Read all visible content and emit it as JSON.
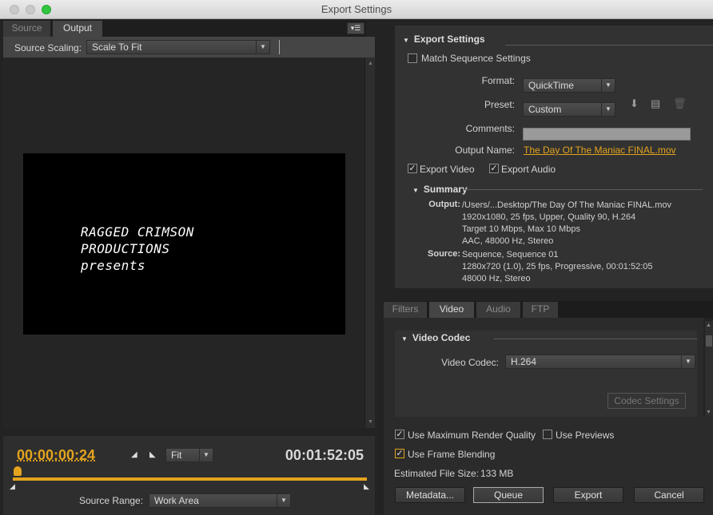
{
  "window": {
    "title": "Export Settings"
  },
  "left": {
    "tabs": [
      {
        "label": "Source"
      },
      {
        "label": "Output"
      }
    ],
    "panel_menu_glyph": "▾☰",
    "source_scaling": {
      "label": "Source Scaling:",
      "value": "Scale To Fit"
    },
    "preview_text": [
      "RAGGED CRIMSON",
      "PRODUCTIONS",
      "presents"
    ],
    "timecode_current": "00:00:00:24",
    "timecode_duration": "00:01:52:05",
    "zoom": "Fit",
    "source_range": {
      "label": "Source Range:",
      "value": "Work Area"
    }
  },
  "export_settings": {
    "title": "Export Settings",
    "match_sequence": {
      "label": "Match Sequence Settings",
      "checked": false
    },
    "format": {
      "label": "Format:",
      "value": "QuickTime"
    },
    "preset": {
      "label": "Preset:",
      "value": "Custom"
    },
    "comments": {
      "label": "Comments:",
      "value": ""
    },
    "output_name": {
      "label": "Output Name:",
      "value": "The Day Of The Maniac FINAL.mov"
    },
    "export_video": {
      "label": "Export Video",
      "checked": true
    },
    "export_audio": {
      "label": "Export Audio",
      "checked": true
    },
    "summary": {
      "title": "Summary",
      "output_label": "Output:",
      "output_lines": [
        "/Users/...Desktop/The Day Of The Maniac FINAL.mov",
        "1920x1080, 25 fps, Upper, Quality 90, H.264",
        "Target 10 Mbps, Max 10 Mbps",
        "AAC, 48000 Hz, Stereo"
      ],
      "source_label": "Source:",
      "source_lines": [
        "Sequence, Sequence 01",
        "1280x720 (1.0), 25 fps, Progressive, 00:01:52:05",
        "48000 Hz, Stereo"
      ]
    }
  },
  "settings_tabs": [
    {
      "label": "Filters"
    },
    {
      "label": "Video"
    },
    {
      "label": "Audio"
    },
    {
      "label": "FTP"
    }
  ],
  "video_codec": {
    "title": "Video Codec",
    "label": "Video Codec:",
    "value": "H.264",
    "settings_button": "Codec Settings"
  },
  "bottom": {
    "max_render": {
      "label": "Use Maximum Render Quality",
      "checked": true
    },
    "use_previews": {
      "label": "Use Previews",
      "checked": false
    },
    "frame_blending": {
      "label": "Use Frame Blending",
      "checked": true
    },
    "file_size_label": "Estimated File Size:",
    "file_size_value": "133 MB",
    "buttons": {
      "metadata": "Metadata...",
      "queue": "Queue",
      "export": "Export",
      "cancel": "Cancel"
    }
  },
  "colors": {
    "accent": "#e3a31e",
    "panel": "#323232",
    "background": "#232323"
  }
}
